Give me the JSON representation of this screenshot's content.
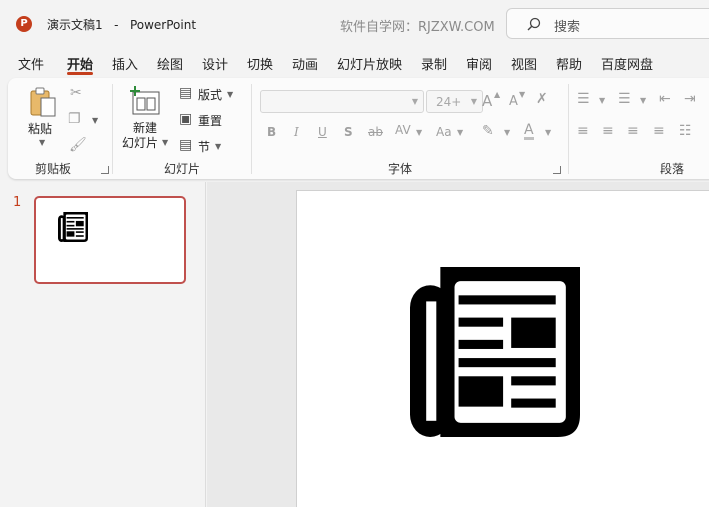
{
  "window": {
    "logo_letter": "P",
    "doc_title": "演示文稿1",
    "separator": "-",
    "app_name": "PowerPoint",
    "watermark": "软件自学网：RJZXW.COM",
    "search_label": "搜索"
  },
  "tabs": [
    {
      "label": "文件"
    },
    {
      "label": "开始",
      "active": true
    },
    {
      "label": "插入"
    },
    {
      "label": "绘图"
    },
    {
      "label": "设计"
    },
    {
      "label": "切换"
    },
    {
      "label": "动画"
    },
    {
      "label": "幻灯片放映"
    },
    {
      "label": "录制"
    },
    {
      "label": "审阅"
    },
    {
      "label": "视图"
    },
    {
      "label": "帮助"
    },
    {
      "label": "百度网盘"
    }
  ],
  "ribbon": {
    "clipboard": {
      "label": "剪贴板",
      "paste": "粘贴"
    },
    "slides": {
      "label": "幻灯片",
      "new_slide_line1": "新建",
      "new_slide_line2": "幻灯片",
      "layout": "版式",
      "reset": "重置",
      "section": "节"
    },
    "font": {
      "label": "字体",
      "font_name": "",
      "font_size": "24+",
      "bold": "B",
      "italic": "I",
      "underline": "U",
      "shadow": "S",
      "strike": "ab",
      "spacing": "AV",
      "change_case": "Aa",
      "font_color": "A",
      "grow": "A",
      "shrink": "A"
    },
    "paragraph": {
      "label": "段落"
    }
  },
  "slides_pane": {
    "slide_number": "1"
  },
  "colors": {
    "accent": "#c43e1c",
    "thumb_border": "#c0504d"
  },
  "icons": {
    "slide_content": "newspaper-icon"
  }
}
